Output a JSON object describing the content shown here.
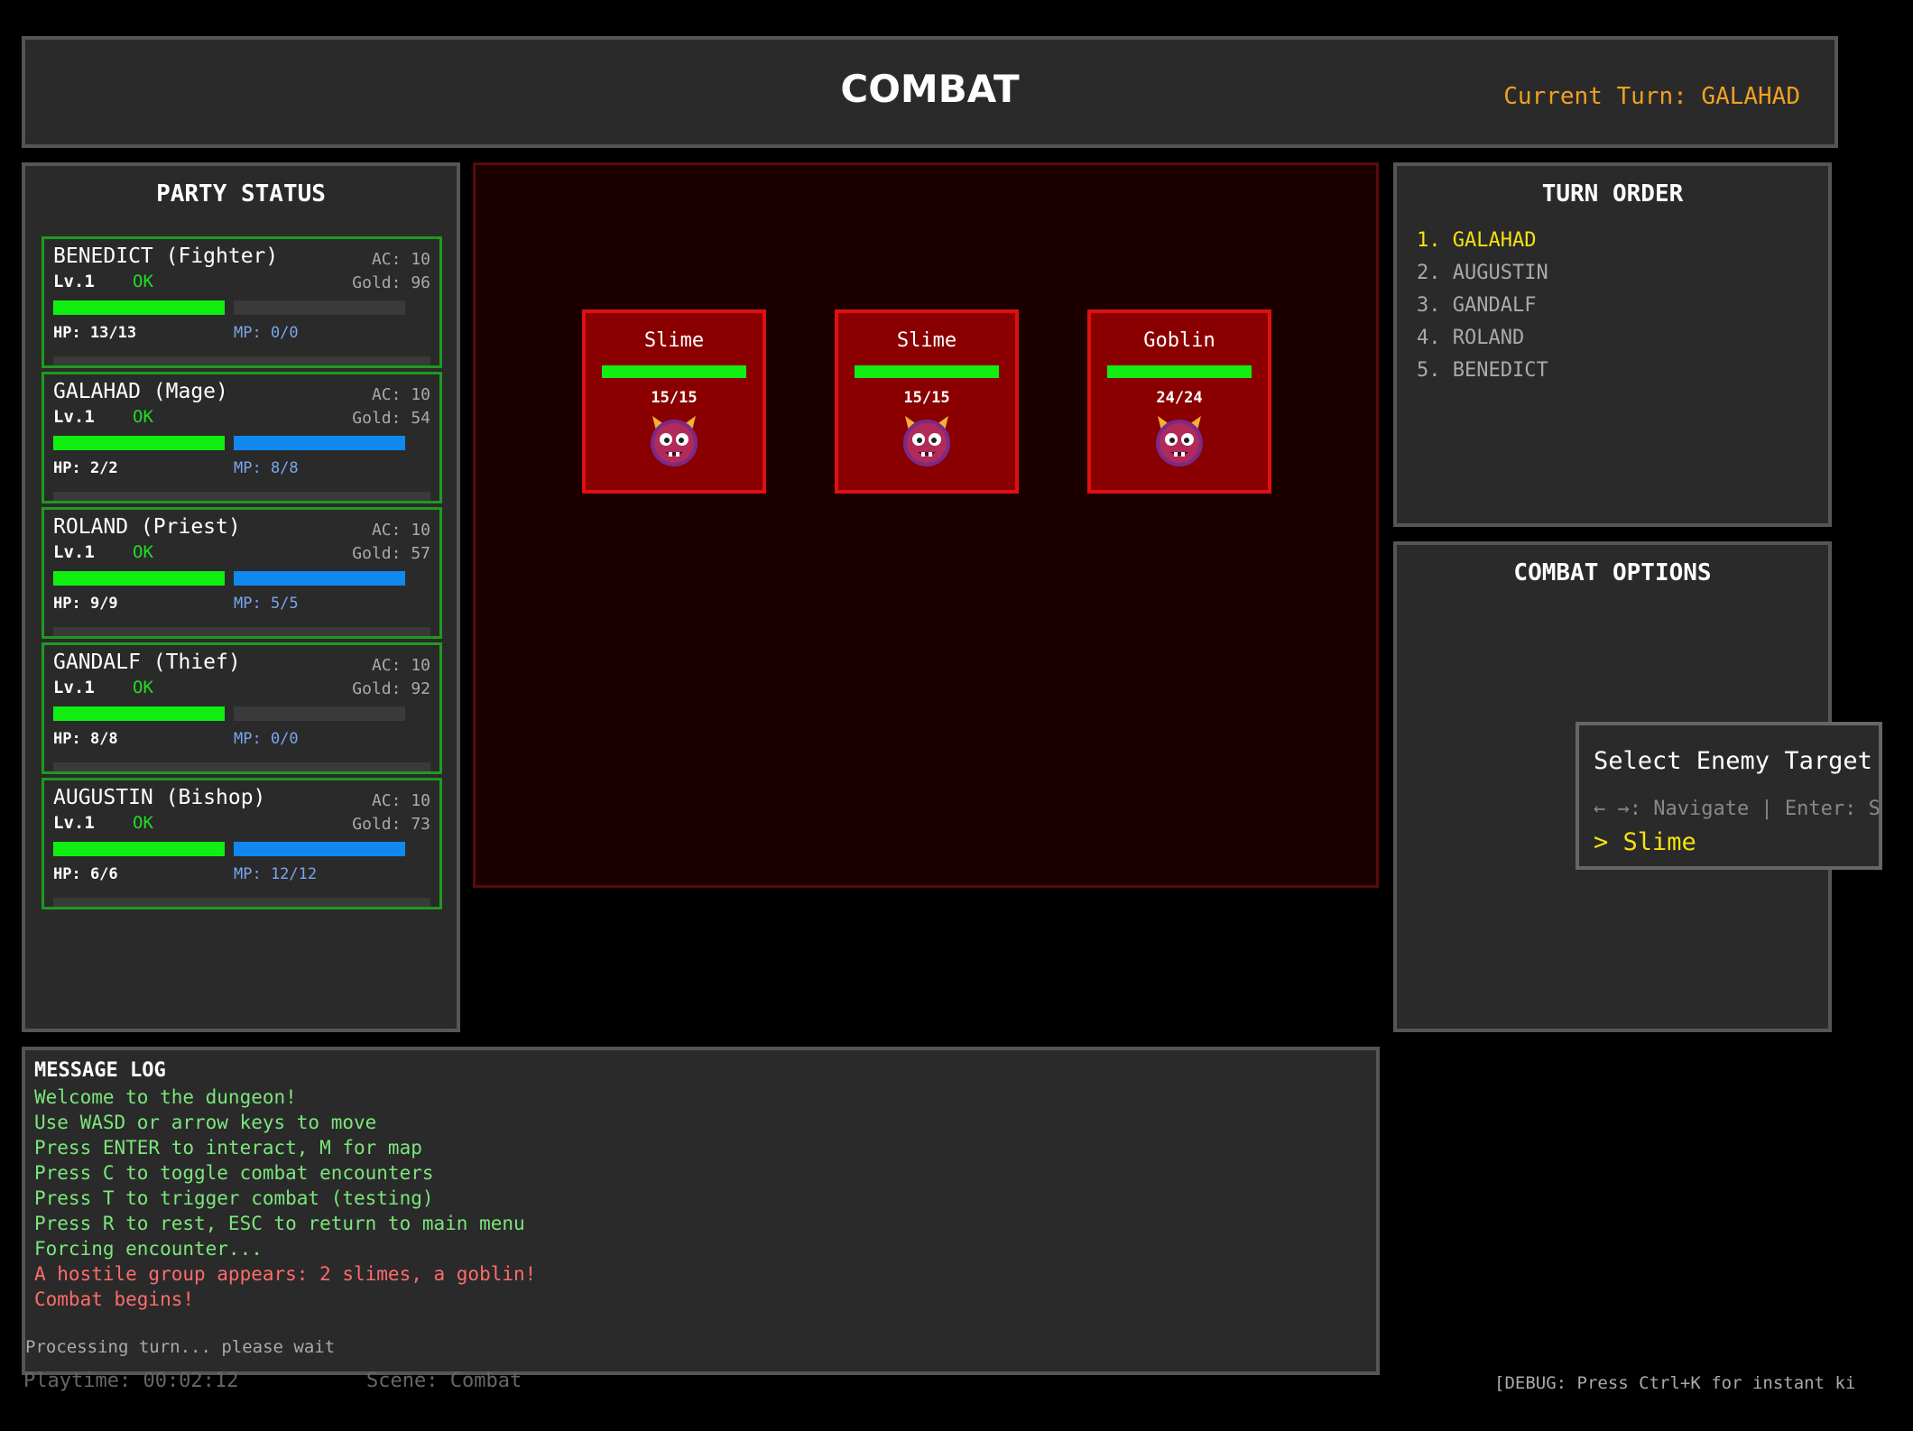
{
  "header": {
    "title": "COMBAT",
    "current_turn": "Current Turn: GALAHAD"
  },
  "party": {
    "title": "PARTY STATUS",
    "members": [
      {
        "name": "BENEDICT (Fighter)",
        "ac": "AC: 10",
        "level": "Lv.1",
        "status": "OK",
        "gold": "Gold: 96",
        "hp": "HP: 13/13",
        "mp": "MP: 0/0",
        "hp_fraction": 1.0,
        "mp_fraction": 0
      },
      {
        "name": "GALAHAD (Mage)",
        "ac": "AC: 10",
        "level": "Lv.1",
        "status": "OK",
        "gold": "Gold: 54",
        "hp": "HP: 2/2",
        "mp": "MP: 8/8",
        "hp_fraction": 1.0,
        "mp_fraction": 1.0
      },
      {
        "name": "ROLAND (Priest)",
        "ac": "AC: 10",
        "level": "Lv.1",
        "status": "OK",
        "gold": "Gold: 57",
        "hp": "HP: 9/9",
        "mp": "MP: 5/5",
        "hp_fraction": 1.0,
        "mp_fraction": 1.0
      },
      {
        "name": "GANDALF (Thief)",
        "ac": "AC: 10",
        "level": "Lv.1",
        "status": "OK",
        "gold": "Gold: 92",
        "hp": "HP: 8/8",
        "mp": "MP: 0/0",
        "hp_fraction": 1.0,
        "mp_fraction": 0
      },
      {
        "name": "AUGUSTIN (Bishop)",
        "ac": "AC: 10",
        "level": "Lv.1",
        "status": "OK",
        "gold": "Gold: 73",
        "hp": "HP: 6/6",
        "mp": "MP: 12/12",
        "hp_fraction": 1.0,
        "mp_fraction": 1.0
      }
    ]
  },
  "enemies": [
    {
      "name": "Slime",
      "hp": "15/15",
      "hp_fraction": 1.0,
      "icon": "ogre-face-icon"
    },
    {
      "name": "Slime",
      "hp": "15/15",
      "hp_fraction": 1.0,
      "icon": "ogre-face-icon"
    },
    {
      "name": "Goblin",
      "hp": "24/24",
      "hp_fraction": 1.0,
      "icon": "ogre-face-icon"
    }
  ],
  "turn_order": {
    "title": "TURN ORDER",
    "items": [
      "1. GALAHAD",
      "2. AUGUSTIN",
      "3. GANDALF",
      "4. ROLAND",
      "5. BENEDICT"
    ]
  },
  "combat_options": {
    "title": "COMBAT OPTIONS",
    "popup_title": "Select Enemy Target",
    "popup_hint": "← →: Navigate | Enter: Select",
    "popup_selected": "> Slime"
  },
  "message_log": {
    "title": "MESSAGE LOG",
    "lines": [
      {
        "text": "Welcome to the dungeon!",
        "color": "#7be67b"
      },
      {
        "text": "Use WASD or arrow keys to move",
        "color": "#7be67b"
      },
      {
        "text": "Press ENTER to interact, M for map",
        "color": "#7be67b"
      },
      {
        "text": "Press C to toggle combat encounters",
        "color": "#7be67b"
      },
      {
        "text": "Press T to trigger combat (testing)",
        "color": "#7be67b"
      },
      {
        "text": "Press R to rest, ESC to return to main menu",
        "color": "#7be67b"
      },
      {
        "text": "Forcing encounter...",
        "color": "#7be67b"
      },
      {
        "text": "A hostile group appears: 2 slimes, a goblin!",
        "color": "#ff6b6b"
      },
      {
        "text": "Combat begins!",
        "color": "#ff6b6b"
      }
    ],
    "processing": "Processing turn... please wait"
  },
  "footer": {
    "playtime": "Playtime: 00:02:12",
    "scene": "Scene: Combat",
    "debug": "[DEBUG: Press Ctrl+K for instant kill]"
  }
}
